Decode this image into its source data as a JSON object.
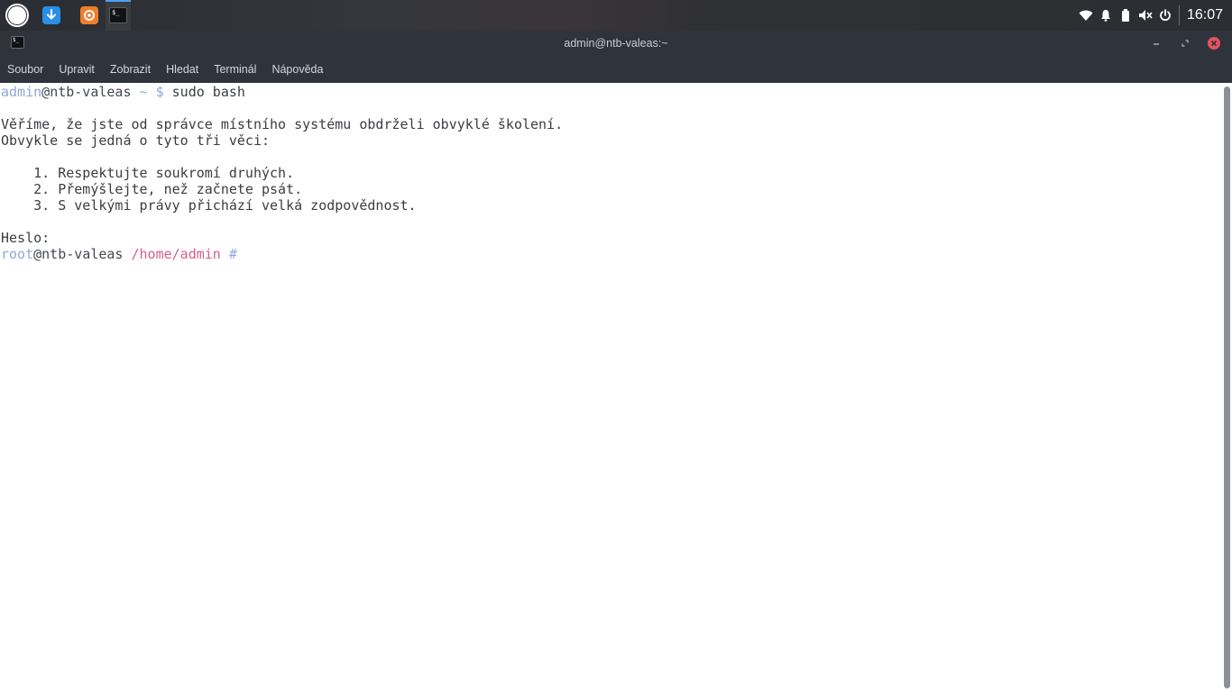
{
  "panel": {
    "clock": "16:07",
    "apps": [
      {
        "name": "menu-icon"
      },
      {
        "name": "download-manager-icon"
      },
      {
        "name": "browser-icon"
      },
      {
        "name": "terminal-icon",
        "glyph": "$_"
      }
    ],
    "tray": [
      "wifi-icon",
      "bell-icon",
      "battery-icon",
      "volume-muted-icon",
      "power-icon"
    ]
  },
  "window": {
    "title": "admin@ntb-valeas:~",
    "icon_glyph": "$_"
  },
  "menubar": {
    "items": [
      "Soubor",
      "Upravit",
      "Zobrazit",
      "Hledat",
      "Terminál",
      "Nápověda"
    ]
  },
  "terminal": {
    "prompt1": {
      "user": "admin",
      "at": "@",
      "host": "ntb-valeas",
      "dir": " ~",
      "symbol": " $",
      "command": " sudo bash"
    },
    "lecture": [
      "",
      "Věříme, že jste od správce místního systému obdrželi obvyklé školení.",
      "Obvykle se jedná o tyto tři věci:",
      "",
      "    1. Respektujte soukromí druhých.",
      "    2. Přemýšlejte, než začnete psát.",
      "    3. S velkými právy přichází velká zodpovědnost.",
      "",
      "Heslo:"
    ],
    "prompt2": {
      "user": "root",
      "at": "@",
      "host": "ntb-valeas",
      "dir": " /home/admin",
      "symbol": " #"
    }
  },
  "colors": {
    "panel_bg": "#2c2e33",
    "titlebar_bg": "#2f343c",
    "accent": "#4d9ff5",
    "close": "#e4535b",
    "prompt_user": "#8fa8d8",
    "prompt_dir": "#d65d8c"
  }
}
